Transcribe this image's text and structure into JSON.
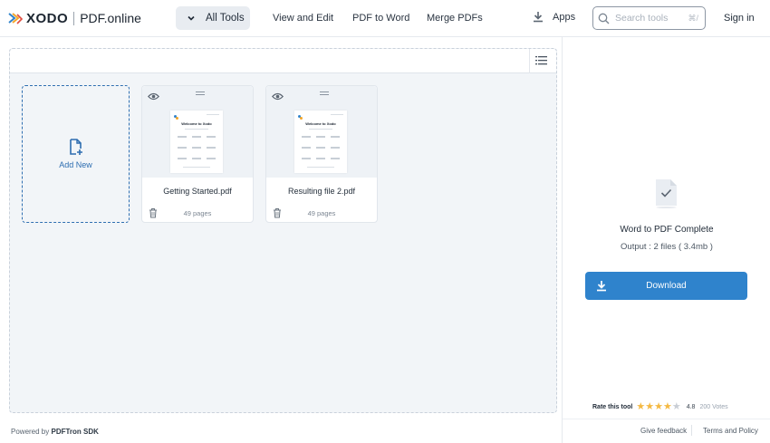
{
  "header": {
    "logo_text": "XODO",
    "logo_sub": "PDF.online",
    "all_tools": "All Tools",
    "nav": [
      "View and Edit",
      "PDF to Word",
      "Merge PDFs"
    ],
    "apps": "Apps",
    "search_placeholder": "Search tools",
    "search_shortcut": "⌘/",
    "sign_in": "Sign in"
  },
  "workspace": {
    "add_new": "Add New",
    "files": [
      {
        "name": "Getting Started.pdf",
        "pages": "49 pages",
        "thumb_title": "Welcome to Xodo"
      },
      {
        "name": "Resulting file 2.pdf",
        "pages": "49 pages",
        "thumb_title": "Welcome to Xodo"
      }
    ]
  },
  "footer": {
    "powered_by": "Powered by",
    "sdk": "PDFTron SDK",
    "feedback": "Give feedback",
    "terms": "Terms and Policy"
  },
  "result": {
    "title": "Word to PDF Complete",
    "output": "Output : 2 files ( 3.4mb )",
    "download": "Download"
  },
  "rating": {
    "label": "Rate this tool",
    "score": "4.8",
    "votes": "200 Votes",
    "stars_filled": 4,
    "stars_total": 5
  },
  "colors": {
    "accent": "#2f83cc",
    "star": "#f4b942",
    "star_empty": "#c9ced5"
  }
}
